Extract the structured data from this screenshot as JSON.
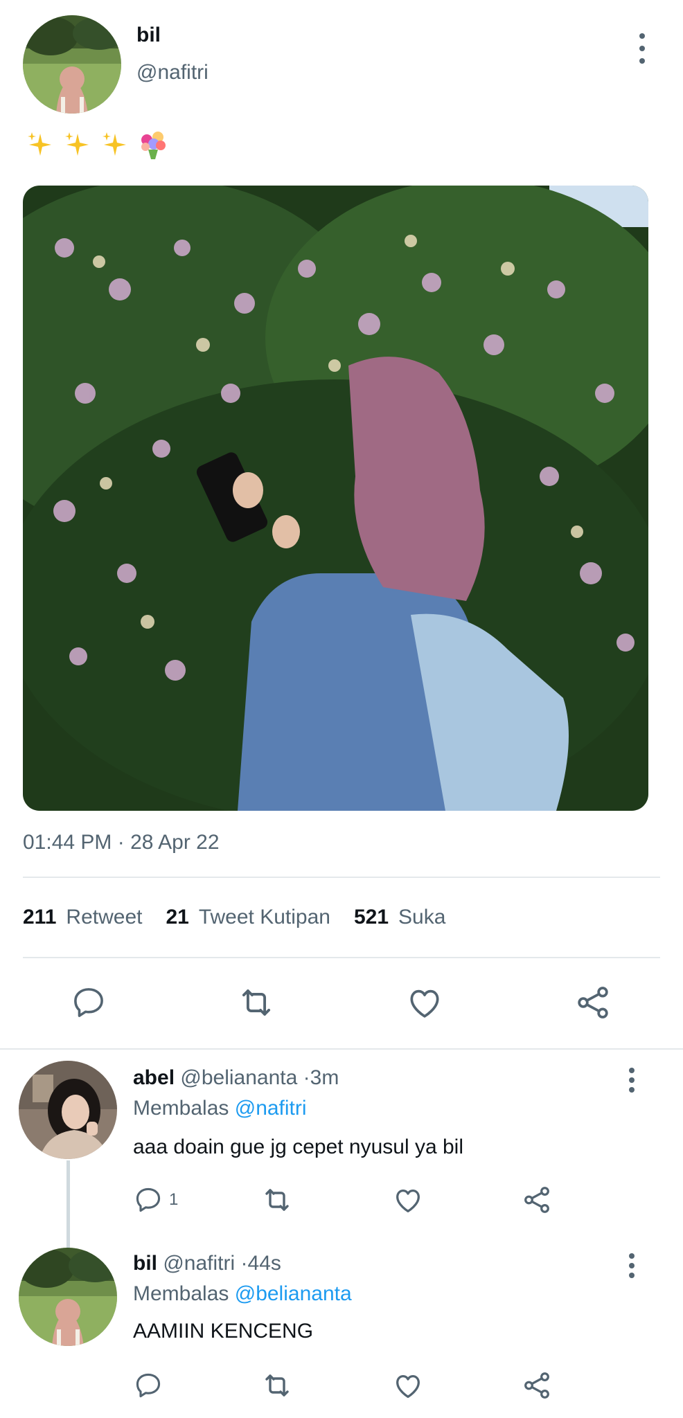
{
  "tweet": {
    "display_name": "bil",
    "handle": "@nafitri",
    "emojis": [
      "sparkles",
      "sparkles",
      "sparkles",
      "bouquet"
    ],
    "time": "01:44 PM",
    "date": "28 Apr 22",
    "stats": {
      "retweets": {
        "count": "211",
        "label": "Retweet"
      },
      "quotes": {
        "count": "21",
        "label": "Tweet Kutipan"
      },
      "likes": {
        "count": "521",
        "label": "Suka"
      }
    }
  },
  "replies": [
    {
      "display_name": "abel",
      "handle": "@beliananta",
      "time": "3m",
      "replying_label": "Membalas",
      "replying_to": "@nafitri",
      "text": "aaa doain gue jg cepet nyusul ya bil",
      "reply_count": "1"
    },
    {
      "display_name": "bil",
      "handle": "@nafitri",
      "time": "44s",
      "replying_label": "Membalas",
      "replying_to": "@beliananta",
      "text": "AAMIIN KENCENG",
      "reply_count": ""
    }
  ],
  "separator": "·",
  "colors": {
    "text": "#0f1419",
    "muted": "#536471",
    "link": "#1d9bf0",
    "divider": "#e4e8eb"
  },
  "icons": [
    "more-vertical-icon",
    "reply-icon",
    "retweet-icon",
    "like-icon",
    "share-icon"
  ]
}
